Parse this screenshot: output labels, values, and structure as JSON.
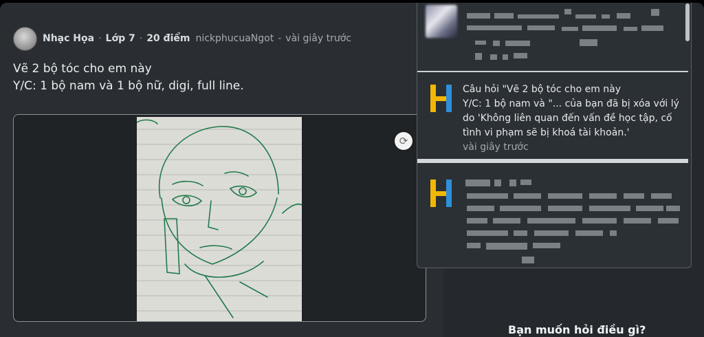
{
  "post": {
    "subject": "Nhạc Họa",
    "grade": "Lớp 7",
    "points": "20 điểm",
    "author": "nickphucuaNgot",
    "time": "vài giây trước",
    "separator": "·",
    "author_separator": "-",
    "body_line1": "Vẽ 2 bộ tóc cho em này",
    "body_line2": "Y/C: 1 bộ nam và 1 bộ nữ, digi, full line."
  },
  "notifications": [
    {
      "icon": "blurred-avatar-icon"
    },
    {
      "icon": "hoc247-h-logo-icon",
      "lines": [
        "Câu hỏi \"Vẽ 2 bộ tóc cho em này",
        "Y/C: 1 bộ nam và  \"... của bạn đã bị xóa với lý",
        "do 'Không liên quan đến vấn đề học tập, cố",
        "tình vi phạm sẽ bị khoá tài khoản.'"
      ],
      "time": "vài giây trước"
    },
    {
      "icon": "hoc247-h-logo-icon"
    }
  ],
  "ask_prompt": "Bạn muốn hỏi điều gì?",
  "colors": {
    "background": "#2a2e33",
    "panel": "#2b3035",
    "logo_yellow": "#f2b705",
    "logo_blue": "#2f8fd8",
    "sketch_ink": "#1f7a4a"
  }
}
